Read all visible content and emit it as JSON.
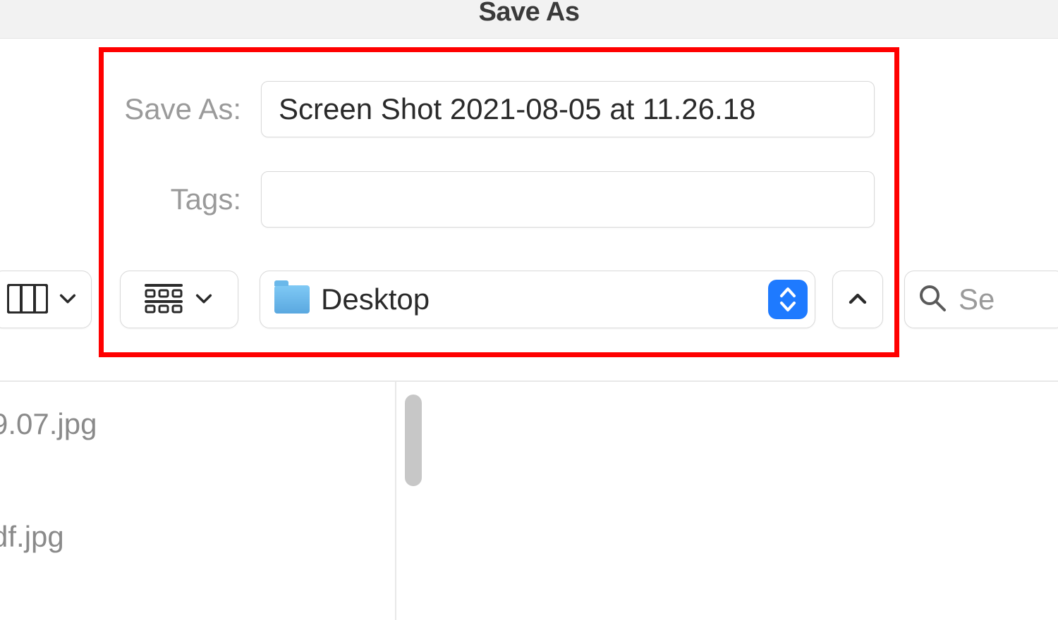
{
  "dialog": {
    "title": "Save As"
  },
  "form": {
    "save_as_label": "Save As:",
    "filename_value": "Screen Shot 2021-08-05 at 11.26.18",
    "tags_label": "Tags:",
    "tags_value": ""
  },
  "toolbar": {
    "location_label": "Desktop",
    "search_placeholder": "Se"
  },
  "files": {
    "item1": "9.07.jpg",
    "item2": "df.jpg"
  }
}
